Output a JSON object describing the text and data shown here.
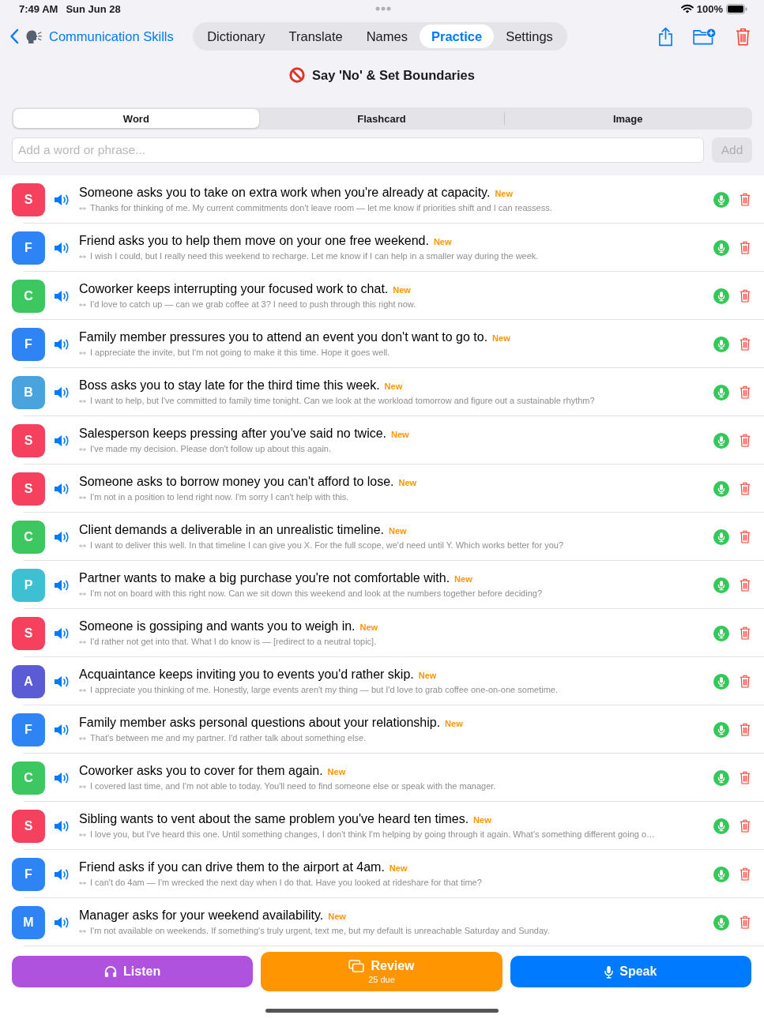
{
  "status_bar": {
    "time": "7:49 AM",
    "date": "Sun Jun 28",
    "battery": "100%"
  },
  "nav": {
    "back_label": "Communication Skills",
    "tabs": [
      {
        "label": "Dictionary",
        "selected": false
      },
      {
        "label": "Translate",
        "selected": false
      },
      {
        "label": "Names",
        "selected": false
      },
      {
        "label": "Practice",
        "selected": true
      },
      {
        "label": "Settings",
        "selected": false
      }
    ]
  },
  "title": "Say 'No' & Set Boundaries",
  "mode_tabs": [
    {
      "label": "Word",
      "selected": true
    },
    {
      "label": "Flashcard",
      "selected": false
    },
    {
      "label": "Image",
      "selected": false
    }
  ],
  "add": {
    "placeholder": "Add a word or phrase...",
    "button": "Add",
    "disabled": true
  },
  "items": [
    {
      "initial": "S",
      "color": "#f5405e",
      "title": "Someone asks you to take on extra work when you're already at capacity.",
      "badge": "New",
      "response": "Thanks for thinking of me. My current commitments don't leave room — let me know if priorities shift and I can reassess."
    },
    {
      "initial": "F",
      "color": "#2f84f5",
      "title": "Friend asks you to help them move on your one free weekend.",
      "badge": "New",
      "response": "I wish I could, but I really need this weekend to recharge. Let me know if I can help in a smaller way during the week."
    },
    {
      "initial": "C",
      "color": "#3cc760",
      "title": "Coworker keeps interrupting your focused work to chat.",
      "badge": "New",
      "response": "I'd love to catch up — can we grab coffee at 3? I need to push through this right now."
    },
    {
      "initial": "F",
      "color": "#2f84f5",
      "title": "Family member pressures you to attend an event you don't want to go to.",
      "badge": "New",
      "response": "I appreciate the invite, but I'm not going to make it this time. Hope it goes well."
    },
    {
      "initial": "B",
      "color": "#4aa3dc",
      "title": "Boss asks you to stay late for the third time this week.",
      "badge": "New",
      "response": "I want to help, but I've committed to family time tonight. Can we look at the workload tomorrow and figure out a sustainable rhythm?"
    },
    {
      "initial": "S",
      "color": "#f5405e",
      "title": "Salesperson keeps pressing after you've said no twice.",
      "badge": "New",
      "response": "I've made my decision. Please don't follow up about this again."
    },
    {
      "initial": "S",
      "color": "#f5405e",
      "title": "Someone asks to borrow money you can't afford to lose.",
      "badge": "New",
      "response": "I'm not in a position to lend right now. I'm sorry I can't help with this."
    },
    {
      "initial": "C",
      "color": "#3cc760",
      "title": "Client demands a deliverable in an unrealistic timeline.",
      "badge": "New",
      "response": "I want to deliver this well. In that timeline I can give you X. For the full scope, we'd need until Y. Which works better for you?"
    },
    {
      "initial": "P",
      "color": "#3ec0d3",
      "title": "Partner wants to make a big purchase you're not comfortable with.",
      "badge": "New",
      "response": "I'm not on board with this right now. Can we sit down this weekend and look at the numbers together before deciding?"
    },
    {
      "initial": "S",
      "color": "#f5405e",
      "title": "Someone is gossiping and wants you to weigh in.",
      "badge": "New",
      "response": "I'd rather not get into that. What I do know is — [redirect to a neutral topic]."
    },
    {
      "initial": "A",
      "color": "#5b5bd6",
      "title": "Acquaintance keeps inviting you to events you'd rather skip.",
      "badge": "New",
      "response": "I appreciate you thinking of me. Honestly, large events aren't my thing — but I'd love to grab coffee one-on-one sometime."
    },
    {
      "initial": "F",
      "color": "#2f84f5",
      "title": "Family member asks personal questions about your relationship.",
      "badge": "New",
      "response": "That's between me and my partner. I'd rather talk about something else."
    },
    {
      "initial": "C",
      "color": "#3cc760",
      "title": "Coworker asks you to cover for them again.",
      "badge": "New",
      "response": "I covered last time, and I'm not able to today. You'll need to find someone else or speak with the manager."
    },
    {
      "initial": "S",
      "color": "#f5405e",
      "title": "Sibling wants to vent about the same problem you've heard ten times.",
      "badge": "New",
      "response": "I love you, but I've heard this one. Until something changes, I don't think I'm helping by going through it again. What's something different going o…"
    },
    {
      "initial": "F",
      "color": "#2f84f5",
      "title": "Friend asks if you can drive them to the airport at 4am.",
      "badge": "New",
      "response": "I can't do 4am — I'm wrecked the next day when I do that. Have you looked at rideshare for that time?"
    },
    {
      "initial": "M",
      "color": "#2f84f5",
      "title": "Manager asks for your weekend availability.",
      "badge": "New",
      "response": "I'm not available on weekends. If something's truly urgent, text me, but my default is unreachable Saturday and Sunday."
    }
  ],
  "actions": [
    {
      "kind": "listen",
      "label": "Listen"
    },
    {
      "kind": "review",
      "label": "Review",
      "detail": "25 due"
    },
    {
      "kind": "speak",
      "label": "Speak"
    }
  ]
}
